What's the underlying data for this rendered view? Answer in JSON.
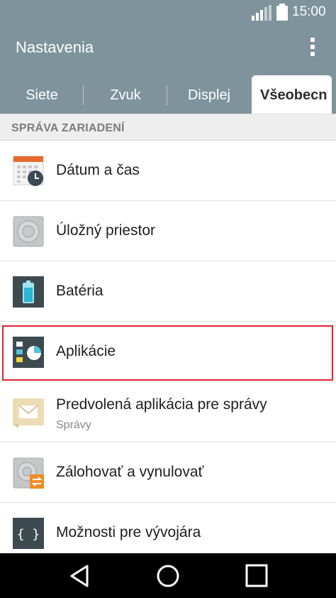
{
  "status_bar": {
    "time": "15:00",
    "signal_icon": "signal-icon",
    "battery_icon": "battery-icon"
  },
  "app_bar": {
    "title": "Nastavenia",
    "menu_icon": "more-vert-icon"
  },
  "tabs": [
    {
      "label": "Siete",
      "active": false
    },
    {
      "label": "Zvuk",
      "active": false
    },
    {
      "label": "Displej",
      "active": false
    },
    {
      "label": "Všeobecn",
      "active": true
    }
  ],
  "section_header": "SPRÁVA ZARIADENÍ",
  "items": [
    {
      "label": "Dátum a čas",
      "icon": "calendar-clock-icon"
    },
    {
      "label": "Úložný priestor",
      "icon": "storage-icon"
    },
    {
      "label": "Batéria",
      "icon": "battery-icon"
    },
    {
      "label": "Aplikácie",
      "icon": "apps-icon",
      "highlighted": true
    },
    {
      "label": "Predvolená aplikácia pre správy",
      "sub": "Správy",
      "icon": "message-icon"
    },
    {
      "label": "Zálohovať a vynulovať",
      "icon": "backup-reset-icon"
    },
    {
      "label": "Možnosti pre vývojára",
      "icon": "developer-options-icon"
    }
  ],
  "colors": {
    "accent": "#7e939b",
    "highlight": "#e02130",
    "navbar": "#000000"
  },
  "nav_bar": {
    "back_icon": "back-icon",
    "home_icon": "home-icon",
    "recents_icon": "recents-icon"
  }
}
